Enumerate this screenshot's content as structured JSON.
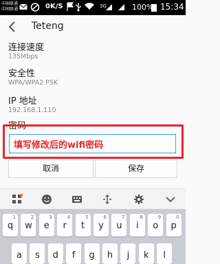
{
  "status_bar": {
    "carrier_line1": "中国联通",
    "carrier_line2": "中国联通",
    "speed": "0K/S",
    "network_label": "3G",
    "battery": "100%",
    "time": "15:34"
  },
  "header": {
    "title": "Teteng"
  },
  "details": [
    {
      "label": "连接速度",
      "value": "135Mbps"
    },
    {
      "label": "安全性",
      "value": "WPA/WPA2 PSK"
    },
    {
      "label": "IP 地址",
      "value": "192.168.1.110"
    }
  ],
  "password": {
    "label": "密码",
    "value": "填写修改后的wifi密码"
  },
  "buttons": {
    "cancel": "取消",
    "save": "保存"
  },
  "keyboard": {
    "row1": [
      {
        "letter": "q",
        "num": "1"
      },
      {
        "letter": "w",
        "num": "2"
      },
      {
        "letter": "e",
        "num": "3"
      },
      {
        "letter": "r",
        "num": "4"
      },
      {
        "letter": "t",
        "num": "5"
      },
      {
        "letter": "y",
        "num": "6"
      },
      {
        "letter": "u",
        "num": "7"
      },
      {
        "letter": "i",
        "num": "8"
      },
      {
        "letter": "o",
        "num": "9"
      },
      {
        "letter": "p",
        "num": "0"
      }
    ],
    "row2_visible": [
      "a",
      "s",
      "d",
      "f",
      "g",
      "h",
      "j",
      "k",
      "l"
    ]
  },
  "colors": {
    "highlight_outline": "#e6262b",
    "input_border": "#3ea0d8",
    "annotation_text": "#e6262b"
  }
}
